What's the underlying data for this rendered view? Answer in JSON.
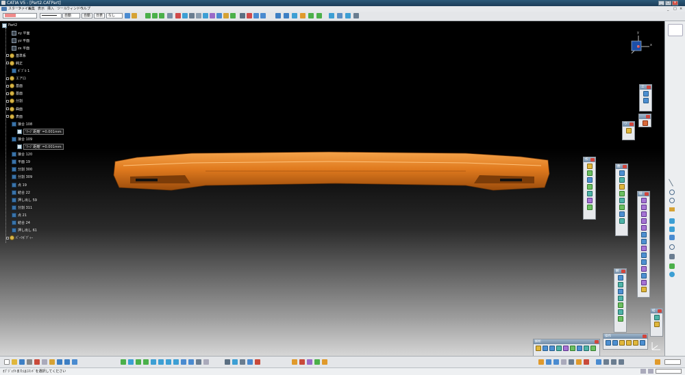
{
  "titlebar": {
    "app_title": "CATIA V5 - [Part2.CATPart]",
    "tab_label": "Part2.CATPart",
    "minimize": "_",
    "maximize": "□",
    "close": "×"
  },
  "menubar": {
    "items": [
      "スタート",
      "ファイル",
      "編集",
      "表示",
      "挿入",
      "ツール",
      "ウィンドウ",
      "ヘルプ"
    ]
  },
  "stylebar": {
    "color_value": "",
    "linetype_value": "",
    "weight_value": "自動",
    "layer_value": "自動",
    "render_value": "自動",
    "mode_value": "日表",
    "filter_value": "なし"
  },
  "tree": {
    "root": "Part2",
    "items": [
      {
        "label": "xy 平面",
        "kind": "plane",
        "indent": 1
      },
      {
        "label": "yz 平面",
        "kind": "plane",
        "indent": 1
      },
      {
        "label": "zx 平面",
        "kind": "plane",
        "indent": 1
      },
      {
        "label": "基準系",
        "kind": "gear",
        "indent": 0
      },
      {
        "label": "純正",
        "kind": "gear",
        "indent": 0
      },
      {
        "label": "ﾎﾞﾌﾞﾙ 1",
        "kind": "surf",
        "indent": 1
      },
      {
        "label": "エアロ",
        "kind": "gear",
        "indent": 0
      },
      {
        "label": "基面",
        "kind": "gear",
        "indent": 0
      },
      {
        "label": "基面",
        "kind": "gear",
        "indent": 0
      },
      {
        "label": "分割",
        "kind": "gear",
        "indent": 0
      },
      {
        "label": "曲面",
        "kind": "gear",
        "indent": 0
      },
      {
        "label": "表面",
        "kind": "gear",
        "indent": 0
      },
      {
        "label": "接合 108",
        "kind": "surf",
        "indent": 1
      },
      {
        "label": "'ﾏｰｼﾞ距離' =0.001mm",
        "kind": "doc",
        "indent": 2,
        "boxed": true
      },
      {
        "label": "接合 109",
        "kind": "surf",
        "indent": 1
      },
      {
        "label": "'ﾏｰｼﾞ距離' =0.001mm",
        "kind": "doc",
        "indent": 2,
        "boxed": true
      },
      {
        "label": "接合 120",
        "kind": "surf",
        "indent": 1
      },
      {
        "label": "平面 19",
        "kind": "surf",
        "indent": 1
      },
      {
        "label": "分割 300",
        "kind": "surf",
        "indent": 1
      },
      {
        "label": "分割 309",
        "kind": "surf",
        "indent": 1
      },
      {
        "label": "点 19",
        "kind": "surf",
        "indent": 1
      },
      {
        "label": "結合 22",
        "kind": "surf",
        "indent": 1
      },
      {
        "label": "押し出し 59",
        "kind": "surf",
        "indent": 1
      },
      {
        "label": "分割 311",
        "kind": "surf",
        "indent": 1
      },
      {
        "label": "点 21",
        "kind": "surf",
        "indent": 1
      },
      {
        "label": "結合 24",
        "kind": "surf",
        "indent": 1
      },
      {
        "label": "押し出し 61",
        "kind": "surf",
        "indent": 1
      },
      {
        "label": "ﾊﾟｰﾂﾎﾞﾃﾞｨｰ",
        "kind": "gear",
        "indent": 0
      }
    ]
  },
  "compass": {
    "x": "x",
    "y": "y",
    "z": "z"
  },
  "palettes": {
    "p1": {
      "title": "工"
    },
    "p2": {
      "title": "作"
    },
    "p3": {
      "title": "ワ"
    },
    "p4": {
      "title": "曲"
    },
    "p5": {
      "title": "操"
    },
    "p6": {
      "title": "解"
    },
    "p7": {
      "title": "結"
    },
    "p8": {
      "title": "操作"
    },
    "p9": {
      "title": "解析"
    },
    "p10": {
      "title": "分析"
    }
  },
  "status": {
    "prompt": "ｵﾌﾞｼﾞｪｸﾄまたはｺﾏﾝﾄﾞを選択してください"
  },
  "colors": {
    "part": "#e07a1e",
    "part_dark": "#9a4c0c",
    "part_light": "#f4a34a",
    "swatch": "#f08a8a"
  }
}
